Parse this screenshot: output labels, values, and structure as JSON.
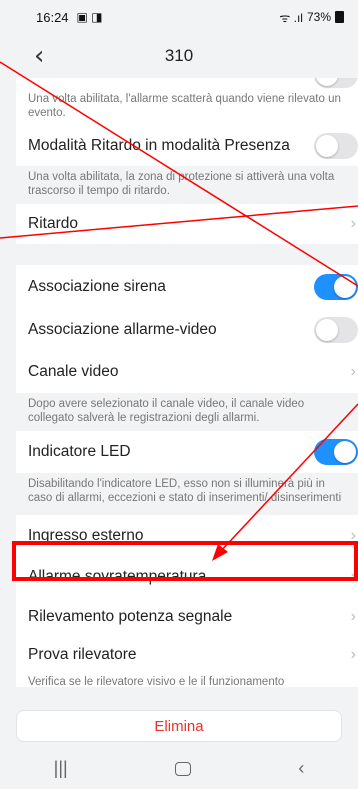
{
  "status_bar": {
    "time": "16:24",
    "battery": "73%",
    "app_icons": "▣ ◨",
    "signal": "ᯤ .ıl"
  },
  "nav": {
    "title": "310",
    "back_glyph": "‹"
  },
  "sections": {
    "top_hint": "Una volta abilitata, l'allarme scatterà quando viene rilevato un evento.",
    "delay_presence_label": "Modalità Ritardo in modalità Presenza",
    "delay_presence_hint": "Una volta abilitata, la zona di protezione si attiverà una volta trascorso il tempo di ritardo.",
    "delay_label": "Ritardo",
    "siren_label": "Associazione sirena",
    "alarm_video_label": "Associazione allarme-video",
    "video_channel_label": "Canale video",
    "video_channel_hint": "Dopo avere selezionato il canale video, il canale video collegato salverà le registrazioni degli allarmi.",
    "led_label": "Indicatore LED",
    "led_hint": "Disabilitando l'indicatore LED, esso non si illuminerà più in caso di allarmi, eccezioni e stato di inserimenti/ disinserimenti",
    "external_input_label": "Ingresso esterno",
    "overtemp_label": "Allarme sovratemperatura",
    "signal_strength_label": "Rilevamento potenza segnale",
    "test_detector_label": "Prova rilevatore",
    "test_detector_hint": "Verifica se le rilevatore visivo e le il funzionamento"
  },
  "toggles": {
    "top": false,
    "delay_presence": false,
    "siren": true,
    "alarm_video": false,
    "led": true
  },
  "chevron_glyph": "›",
  "delete_button": "Elimina",
  "system_nav": {
    "recents": "|||",
    "back": "‹"
  },
  "colors": {
    "accent": "#1e90ff",
    "delete": "#e8322a",
    "annotation": "#ff0000"
  }
}
